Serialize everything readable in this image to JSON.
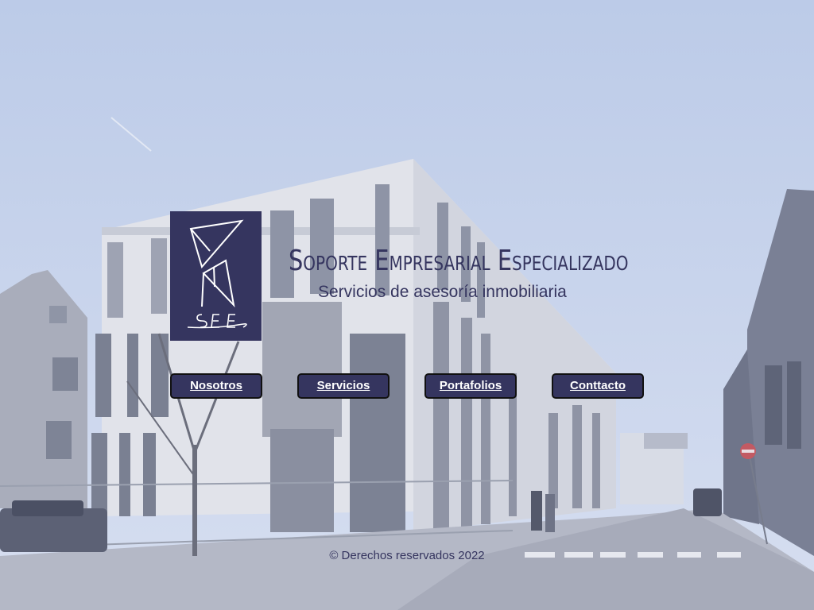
{
  "header": {
    "logo_text": "SEE",
    "title": "Soporte Empresarial Especializado",
    "subtitle": "Servicios de asesoría inmobiliaria"
  },
  "nav": {
    "items": [
      {
        "label": "Nosotros"
      },
      {
        "label": "Servicios"
      },
      {
        "label": "Portafolios"
      },
      {
        "label": "Conttacto"
      }
    ]
  },
  "footer": {
    "text": "© Derechos reservados 2022"
  },
  "colors": {
    "brand": "#35355f",
    "button_text": "#ffffff"
  },
  "icons": {
    "logo": "see-triangles-logo-icon"
  }
}
